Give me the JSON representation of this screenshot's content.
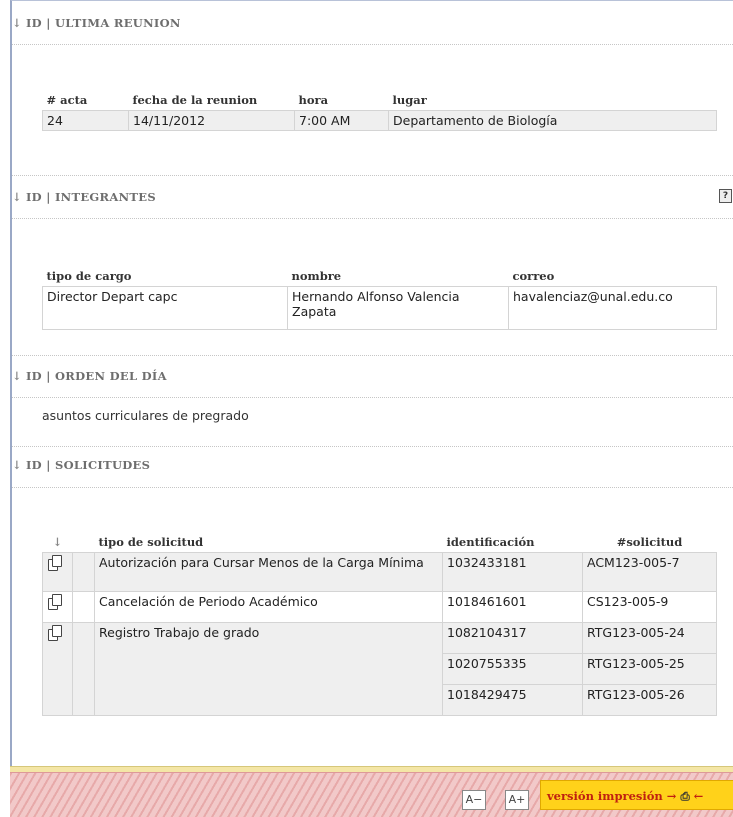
{
  "sections": {
    "ultima_reunion": {
      "title": "ID | ULTIMA REUNION"
    },
    "integrantes": {
      "title": "ID | INTEGRANTES"
    },
    "orden_del_dia": {
      "title": "ID | ORDEN DEL DÍA",
      "text": "asuntos curriculares de pregrado"
    },
    "solicitudes": {
      "title": "ID | SOLICITUDES"
    }
  },
  "reunion_table": {
    "headers": [
      "# acta",
      "fecha de la reunion",
      "hora",
      "lugar"
    ],
    "row": [
      "24",
      "14/11/2012",
      "7:00 AM",
      "Departamento de Biología"
    ]
  },
  "integrantes_table": {
    "headers": [
      "tipo de cargo",
      "nombre",
      "correo"
    ],
    "row": [
      "Director Depart capc",
      "Hernando Alfonso Valencia Zapata",
      "havalenciaz@unal.edu.co"
    ]
  },
  "solicitudes_table": {
    "headers": [
      "tipo de solicitud",
      "identificación",
      "#solicitud"
    ],
    "rows": [
      {
        "tipo": "Autorización para Cursar Menos de la Carga Mínima",
        "id": "1032433181",
        "num": "ACM123-005-7"
      },
      {
        "tipo": "Cancelación de Periodo Académico",
        "id": "1018461601",
        "num": "CS123-005-9"
      },
      {
        "tipo": "Registro Trabajo de grado",
        "id": "1082104317",
        "num": "RTG123-005-24"
      },
      {
        "tipo": "",
        "id": "1020755335",
        "num": "RTG123-005-25"
      },
      {
        "tipo": "",
        "id": "1018429475",
        "num": "RTG123-005-26"
      }
    ]
  },
  "footer": {
    "print_label": "versión impresión",
    "zoom_out_icon": "zoom-out-icon",
    "zoom_in_icon": "zoom-in-icon",
    "printer_icon": "printer-icon"
  },
  "icons": {
    "section_arrow": "down-arrow-icon",
    "help": "help-icon",
    "copy": "copy-icon"
  },
  "colors": {
    "footer_yellow": "#ffd21a",
    "footer_red_stripes": "#e7a9a9",
    "print_label": "#c02010",
    "row_gray": "#efefef"
  }
}
